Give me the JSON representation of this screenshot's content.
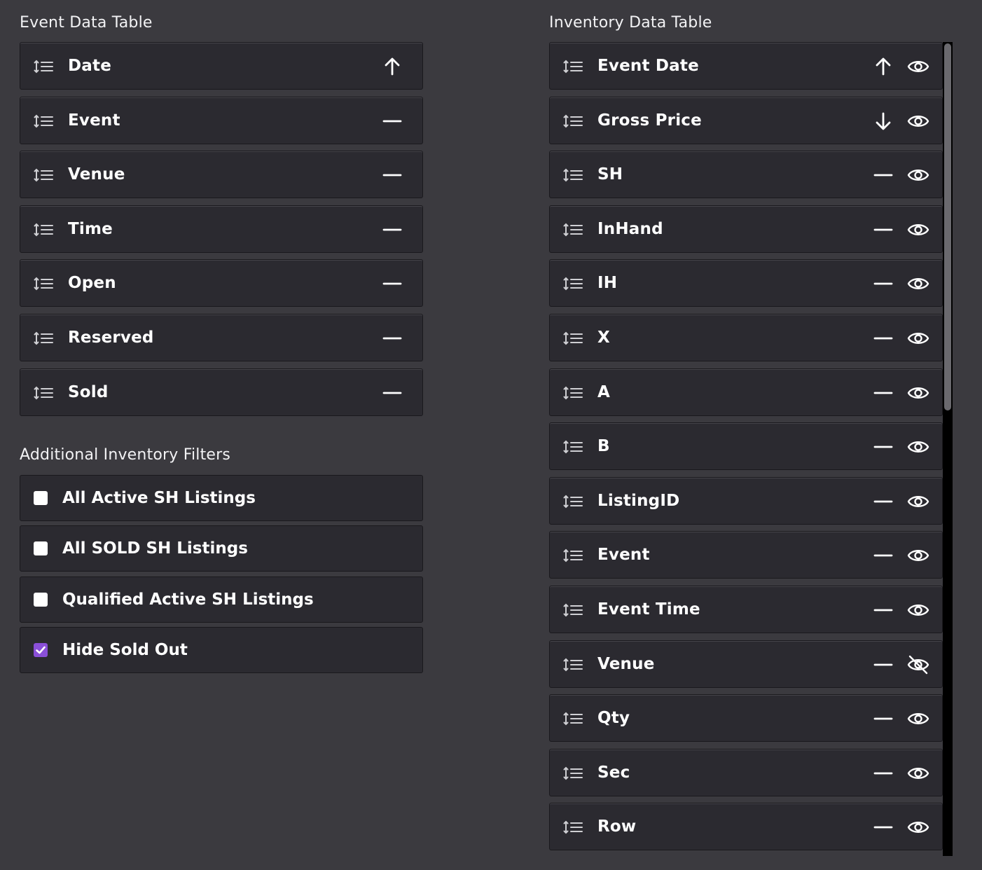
{
  "event_table": {
    "title": "Event Data Table",
    "columns": [
      {
        "label": "Date",
        "sort": "ascending"
      },
      {
        "label": "Event",
        "sort": "none"
      },
      {
        "label": "Venue",
        "sort": "none"
      },
      {
        "label": "Time",
        "sort": "none"
      },
      {
        "label": "Open",
        "sort": "none"
      },
      {
        "label": "Reserved",
        "sort": "none"
      },
      {
        "label": "Sold",
        "sort": "none"
      }
    ]
  },
  "filters": {
    "title": "Additional Inventory Filters",
    "items": [
      {
        "label": "All Active SH Listings",
        "checked": false
      },
      {
        "label": "All SOLD SH Listings",
        "checked": false
      },
      {
        "label": "Qualified Active SH Listings",
        "checked": false
      },
      {
        "label": "Hide Sold Out",
        "checked": true
      }
    ]
  },
  "inventory_table": {
    "title": "Inventory Data Table",
    "columns": [
      {
        "label": "Event Date",
        "sort": "ascending",
        "visible": true
      },
      {
        "label": "Gross Price",
        "sort": "descending",
        "visible": true
      },
      {
        "label": "SH",
        "sort": "none",
        "visible": true
      },
      {
        "label": "InHand",
        "sort": "none",
        "visible": true
      },
      {
        "label": "IH",
        "sort": "none",
        "visible": true
      },
      {
        "label": "X",
        "sort": "none",
        "visible": true
      },
      {
        "label": "A",
        "sort": "none",
        "visible": true
      },
      {
        "label": "B",
        "sort": "none",
        "visible": true
      },
      {
        "label": "ListingID",
        "sort": "none",
        "visible": true
      },
      {
        "label": "Event",
        "sort": "none",
        "visible": true
      },
      {
        "label": "Event Time",
        "sort": "none",
        "visible": true
      },
      {
        "label": "Venue",
        "sort": "none",
        "visible": false
      },
      {
        "label": "Qty",
        "sort": "none",
        "visible": true
      },
      {
        "label": "Sec",
        "sort": "none",
        "visible": true
      },
      {
        "label": "Row",
        "sort": "none",
        "visible": true
      }
    ]
  },
  "icons": {
    "drag_handle": "drag-handle-icon",
    "sort_ascending": "arrow-up-icon",
    "sort_descending": "arrow-down-icon",
    "sort_none": "minus-icon",
    "visible": "eye-icon",
    "hidden": "eye-off-icon"
  },
  "colors": {
    "background": "#3b3a3f",
    "row": "#2b2a30",
    "checkbox_checked": "#8a4fd8"
  }
}
